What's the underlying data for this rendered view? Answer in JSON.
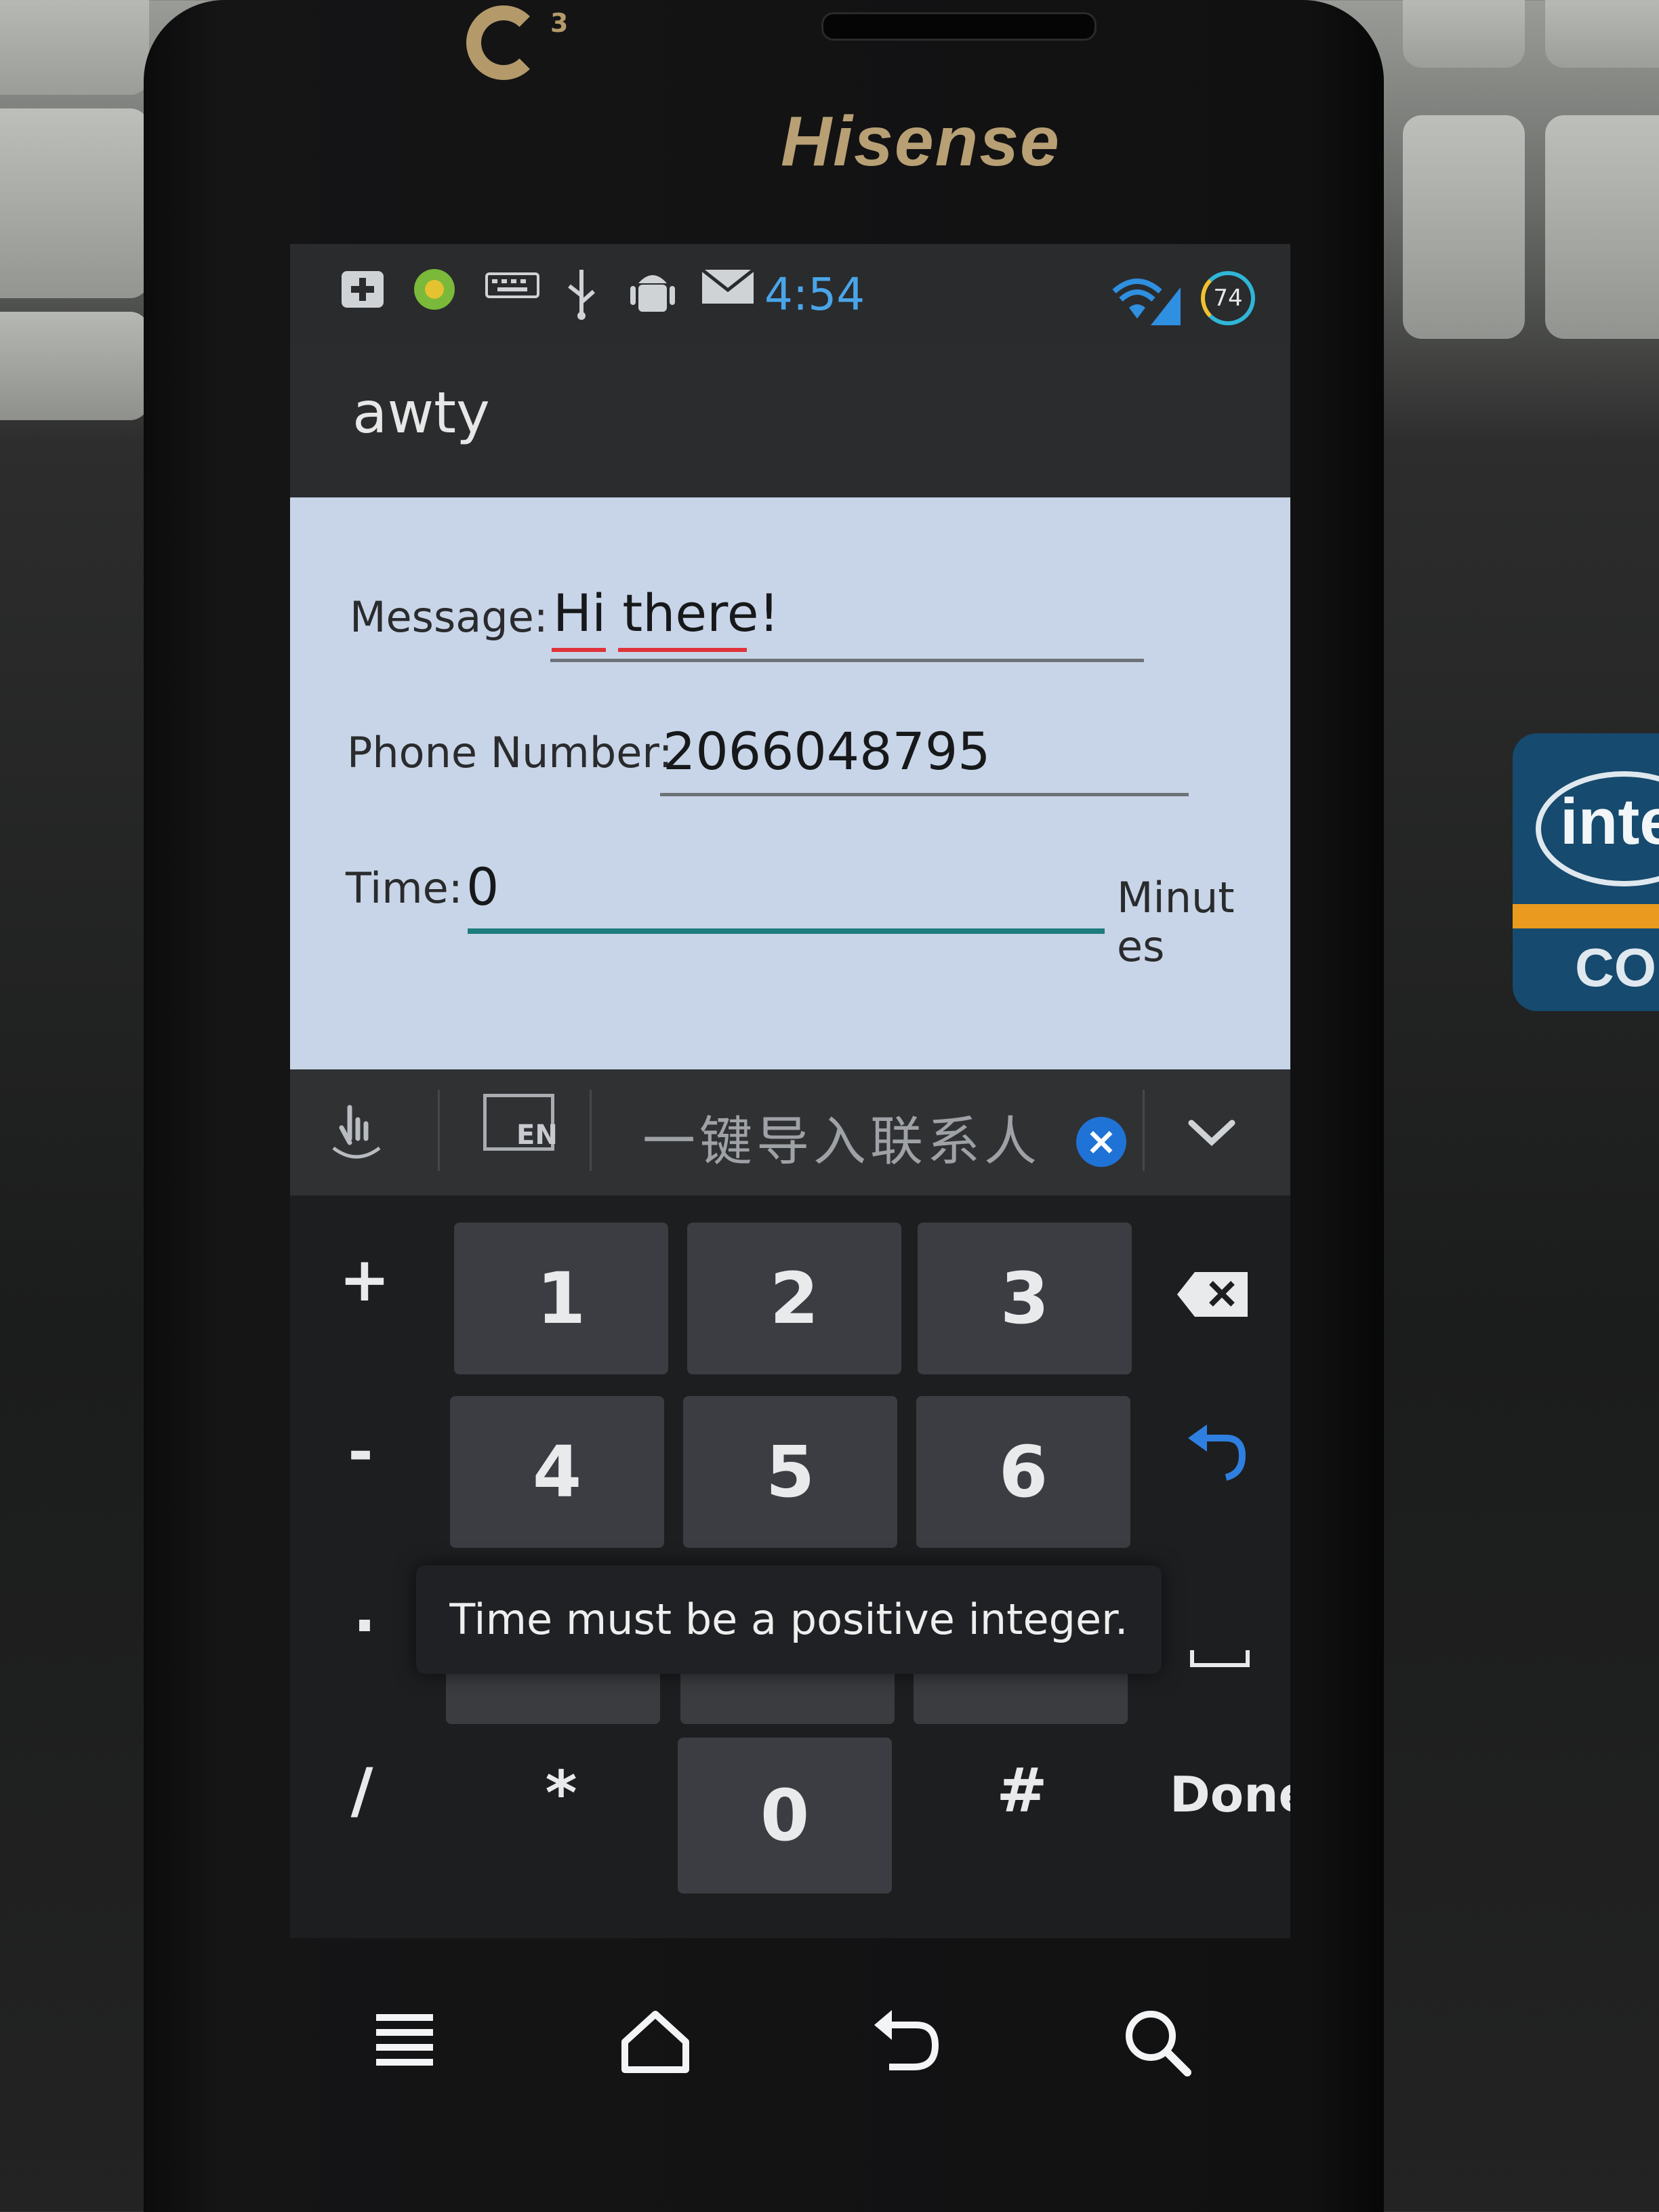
{
  "phone": {
    "brand": "Hisense",
    "carrier_logo_sup": "3"
  },
  "status_bar": {
    "time": "4:54",
    "battery_percent": "74",
    "icons": [
      "add-notification-icon",
      "app-notification-icon",
      "keyboard-icon",
      "usb-icon",
      "android-debug-icon",
      "mail-icon",
      "wifi-icon",
      "cell-signal-icon",
      "battery-icon"
    ]
  },
  "app": {
    "title": "awty",
    "form": {
      "message_label": "Message:",
      "message_value": "Hi there!",
      "phone_label": "Phone Number:",
      "phone_value": "2066048795",
      "time_label": "Time:",
      "time_value": "0",
      "minutes_line1": "Minut",
      "minutes_line2": "es"
    }
  },
  "ime": {
    "suggestion_text": "一键导入联系人",
    "lang_badge": "EN"
  },
  "keyboard": {
    "digits": [
      "1",
      "2",
      "3",
      "4",
      "5",
      "6",
      "0"
    ],
    "symbols": {
      "plus": "+",
      "minus": "-",
      "dot": ".",
      "slash": "/",
      "star": "*",
      "hash": "#"
    },
    "done_label": "Done"
  },
  "toast": {
    "message": "Time must be a positive integer."
  },
  "background": {
    "sticker_word": "intel",
    "sticker_sub": "COR",
    "colors": {
      "sticker": "#164a6e",
      "sticker_bar": "#e99a1f"
    }
  }
}
